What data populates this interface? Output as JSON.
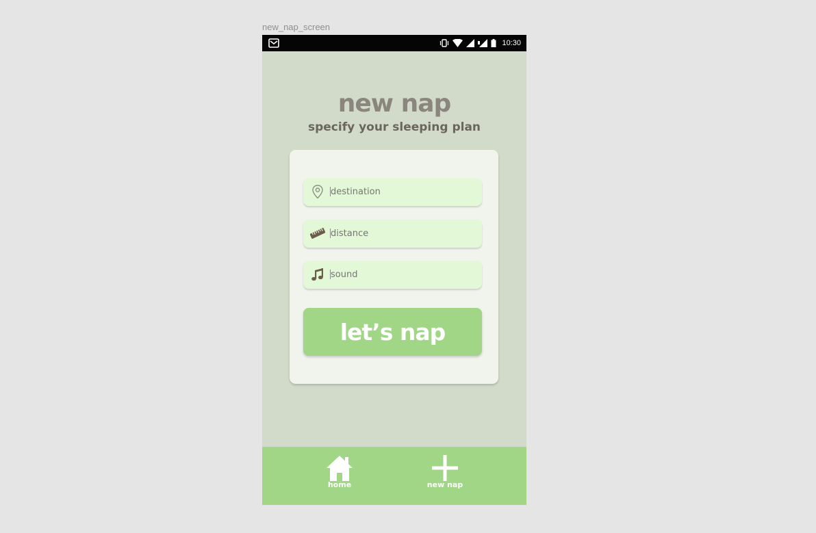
{
  "frame": {
    "label": "new_nap_screen"
  },
  "status_bar": {
    "time": "10:30",
    "left_icon": "gmail-icon",
    "icons": [
      "vibrate-icon",
      "wifi-icon",
      "signal-icon",
      "signal-icon",
      "battery-icon"
    ]
  },
  "header": {
    "title": "new nap",
    "subtitle": "specify your sleeping plan"
  },
  "form": {
    "fields": [
      {
        "icon": "location-pin-icon",
        "placeholder": "destination"
      },
      {
        "icon": "ruler-icon",
        "placeholder": "distance"
      },
      {
        "icon": "music-note-icon",
        "placeholder": "sound"
      }
    ],
    "submit_label": "let’s nap"
  },
  "nav": {
    "items": [
      {
        "icon": "home-icon",
        "label": "home"
      },
      {
        "icon": "plus-icon",
        "label": "new nap"
      }
    ]
  },
  "colors": {
    "background": "#d2dbc9",
    "card": "#f1f4ed",
    "field": "#e2f8d7",
    "accent": "#a0d685",
    "title": "#8a867e",
    "subtitle": "#6b665d"
  }
}
